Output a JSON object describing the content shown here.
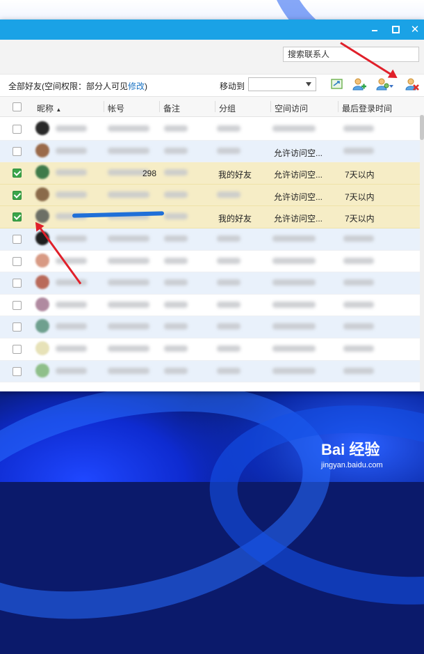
{
  "window": {
    "close_symbol": "✕"
  },
  "search": {
    "placeholder": "搜索联系人"
  },
  "toolbar": {
    "summary_prefix": "全部好友(空间权限：部分人可见",
    "summary_link": "修改",
    "summary_suffix": ")",
    "move_to_label": "移动到",
    "move_to_value": ""
  },
  "table": {
    "columns": [
      "昵称",
      "帐号",
      "备注",
      "分组",
      "空间访问",
      "最后登录时间"
    ],
    "sort_indicator": "▲",
    "rows": [
      {
        "checked": false,
        "account": "",
        "group": "",
        "space": "",
        "last_login": ""
      },
      {
        "checked": false,
        "account": "",
        "group": "",
        "space": "允许访问空...",
        "last_login": ""
      },
      {
        "checked": true,
        "account": "298",
        "group": "我的好友",
        "space": "允许访问空...",
        "last_login": "7天以内"
      },
      {
        "checked": true,
        "account": "",
        "group": "",
        "space": "允许访问空...",
        "last_login": "7天以内"
      },
      {
        "checked": true,
        "account": "",
        "group": "我的好友",
        "space": "允许访问空...",
        "last_login": "7天以内"
      },
      {
        "checked": false,
        "account": "",
        "group": "",
        "space": "",
        "last_login": ""
      },
      {
        "checked": false,
        "account": "",
        "group": "",
        "space": "",
        "last_login": ""
      },
      {
        "checked": false,
        "account": "",
        "group": "",
        "space": "",
        "last_login": ""
      },
      {
        "checked": false,
        "account": "",
        "group": "",
        "space": "",
        "last_login": ""
      },
      {
        "checked": false,
        "account": "",
        "group": "",
        "space": "",
        "last_login": ""
      },
      {
        "checked": false,
        "account": "",
        "group": "",
        "space": "",
        "last_login": ""
      },
      {
        "checked": false,
        "account": "",
        "group": "",
        "space": "",
        "last_login": ""
      }
    ]
  },
  "colors": {
    "titlebar": "#1aa2e6",
    "selected_row": "#f6edc6",
    "checkbox_checked": "#3aa54a",
    "annotation_arrow": "#e0202a",
    "link": "#1a73c4"
  },
  "icons": [
    "minimize-icon",
    "maximize-icon",
    "close-icon",
    "export-contact-icon",
    "add-contact-icon",
    "group-manage-icon",
    "delete-contact-icon"
  ],
  "watermark": {
    "logo": "Bai 经验",
    "url": "jingyan.baidu.com"
  }
}
